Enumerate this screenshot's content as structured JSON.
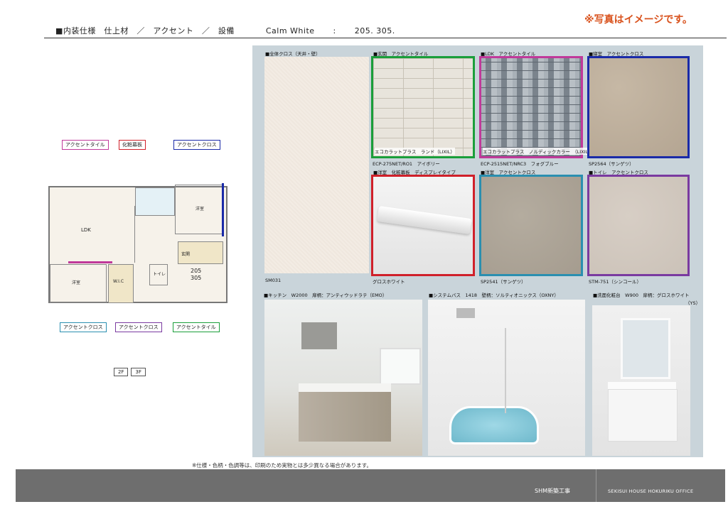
{
  "header": {
    "title": "■内装仕様　仕上材　／　アクセント　／　設備",
    "series": "Calm White",
    "colon": ":",
    "rooms": "205. 305.",
    "image_note": "※写真はイメージです。"
  },
  "floorplan": {
    "callouts_top": [
      "アクセントタイル",
      "化粧幕板",
      "アクセントクロス"
    ],
    "callouts_bottom": [
      "アクセントクロス",
      "アクセントクロス",
      "アクセントタイル"
    ],
    "room_labels": {
      "ldk": "LDK",
      "western_right": "洋室",
      "western_left": "洋室",
      "wic": "W.I.C",
      "entrance": "玄関",
      "toilet": "トイレ",
      "unit_no_1": "205",
      "unit_no_2": "305"
    },
    "floor_buttons": [
      "2F",
      "3F"
    ]
  },
  "materials": [
    {
      "heading": "■全体クロス（天井・壁）",
      "code": "SM031",
      "caption_inner": "",
      "border": "none"
    },
    {
      "heading": "■玄関　アクセントタイル",
      "caption_inner": "エコカラットプラス　ランド（LIXIL）",
      "code": "ECP-275NET/RO1　アイボリー",
      "border": "#1a9e3a"
    },
    {
      "heading": "■LDK　アクセントタイル",
      "caption_inner": "エコカラットプラス　ノルディックカラー　（LIXIL）",
      "code": "ECP-2515NET/NRC3　フォグブルー",
      "border": "#c0399a"
    },
    {
      "heading": "■寝室　アクセントクロス",
      "caption_inner": "",
      "code": "SP2564（サンゲツ）",
      "border": "#1a2aa8"
    },
    {
      "heading": "■洋室　化粧幕板　ディスプレイタイプ",
      "caption_inner": "",
      "code": "グロスホワイト",
      "border": "#d0202a"
    },
    {
      "heading": "■洋室　アクセントクロス",
      "caption_inner": "",
      "code": "SP2541（サンゲツ）",
      "border": "#2a8fb0"
    },
    {
      "heading": "■トイレ　アクセントクロス",
      "caption_inner": "",
      "code": "STM-751（シンコール）",
      "border": "#7a3aa0"
    }
  ],
  "equipment": [
    {
      "heading": "■キッチン　W2000　扉柄：アンティウッドラテ（EMO）"
    },
    {
      "heading": "■システムバス　1418　壁柄：ソルティオニックス（OXNY）"
    },
    {
      "heading": "■洗面化粧台　W900　扉柄：グロスホワイト",
      "sub": "（YS）"
    }
  ],
  "disclaimer": "※仕様・色柄・色調等は、印刷のため実物とは多少異なる場合があります。",
  "footer": {
    "left": "SHM新築工事",
    "right": "SEKISUI HOUSE HOKURIKU OFFICE"
  }
}
